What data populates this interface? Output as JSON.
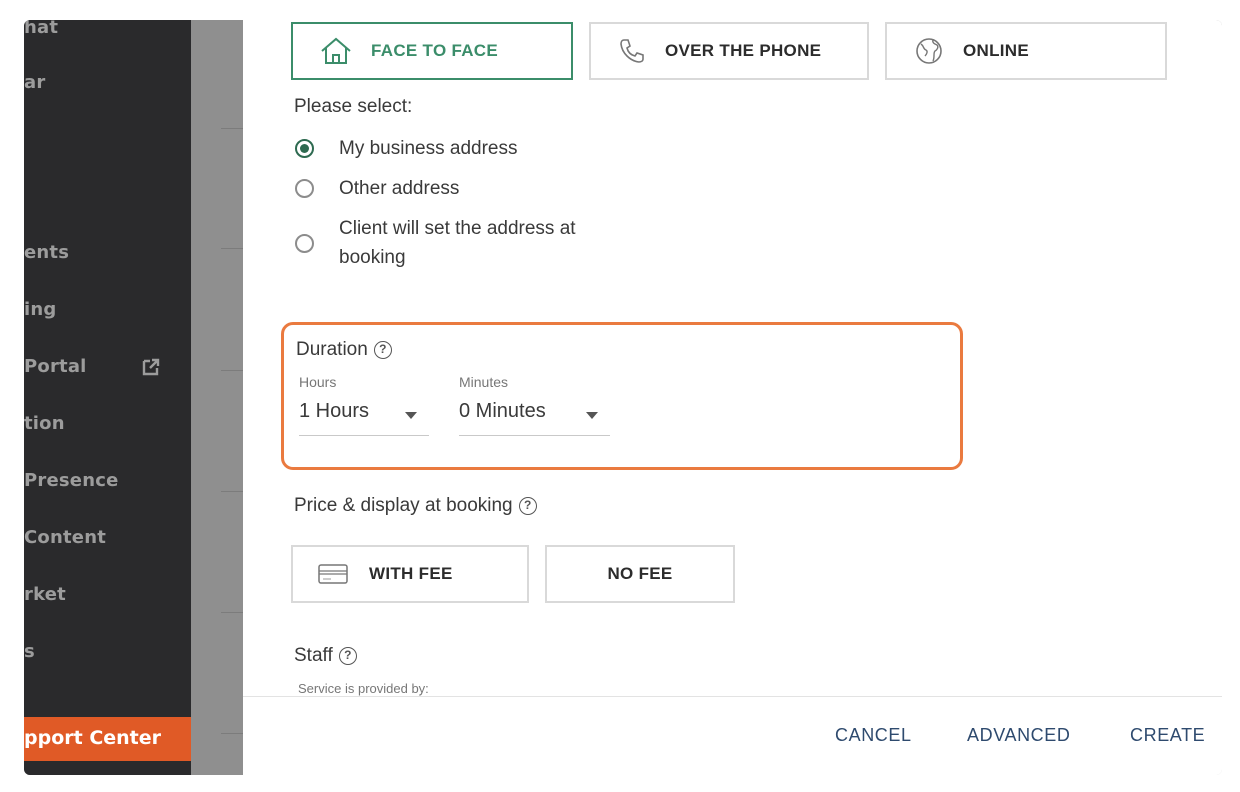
{
  "sidebar": {
    "items": [
      {
        "label": "hat"
      },
      {
        "label": "ar"
      },
      {
        "label": "ents"
      },
      {
        "label": "ing"
      },
      {
        "label": "Portal"
      },
      {
        "label": "tion"
      },
      {
        "label": "Presence"
      },
      {
        "label": "Content"
      },
      {
        "label": "rket"
      },
      {
        "label": "s"
      }
    ],
    "support_label": "pport Center"
  },
  "location_tabs": [
    {
      "label": "FACE TO FACE",
      "icon": "house-icon",
      "active": true
    },
    {
      "label": "OVER THE PHONE",
      "icon": "phone-icon",
      "active": false
    },
    {
      "label": "ONLINE",
      "icon": "globe-icon",
      "active": false
    }
  ],
  "address": {
    "prompt": "Please select:",
    "options": [
      {
        "label": "My business address",
        "selected": true
      },
      {
        "label": "Other address",
        "selected": false
      },
      {
        "label_line1": "Client will set the address at",
        "label_line2": "booking",
        "selected": false
      }
    ]
  },
  "duration": {
    "title": "Duration",
    "help": "?",
    "hours_label": "Hours",
    "hours_value": "1 Hours",
    "minutes_label": "Minutes",
    "minutes_value": "0 Minutes"
  },
  "price": {
    "title": "Price & display at booking",
    "help": "?",
    "with_fee_label": "WITH FEE",
    "no_fee_label": "NO FEE"
  },
  "staff": {
    "title": "Staff",
    "help": "?",
    "subtitle": "Service is provided by:"
  },
  "footer": {
    "cancel_label": "CANCEL",
    "advanced_label": "ADVANCED",
    "create_label": "CREATE"
  },
  "colors": {
    "accent_green": "#3b8d6a",
    "highlight_orange": "#ea7a3f",
    "support_orange": "#e05a26",
    "sidebar_bg": "#2a2a2c"
  }
}
